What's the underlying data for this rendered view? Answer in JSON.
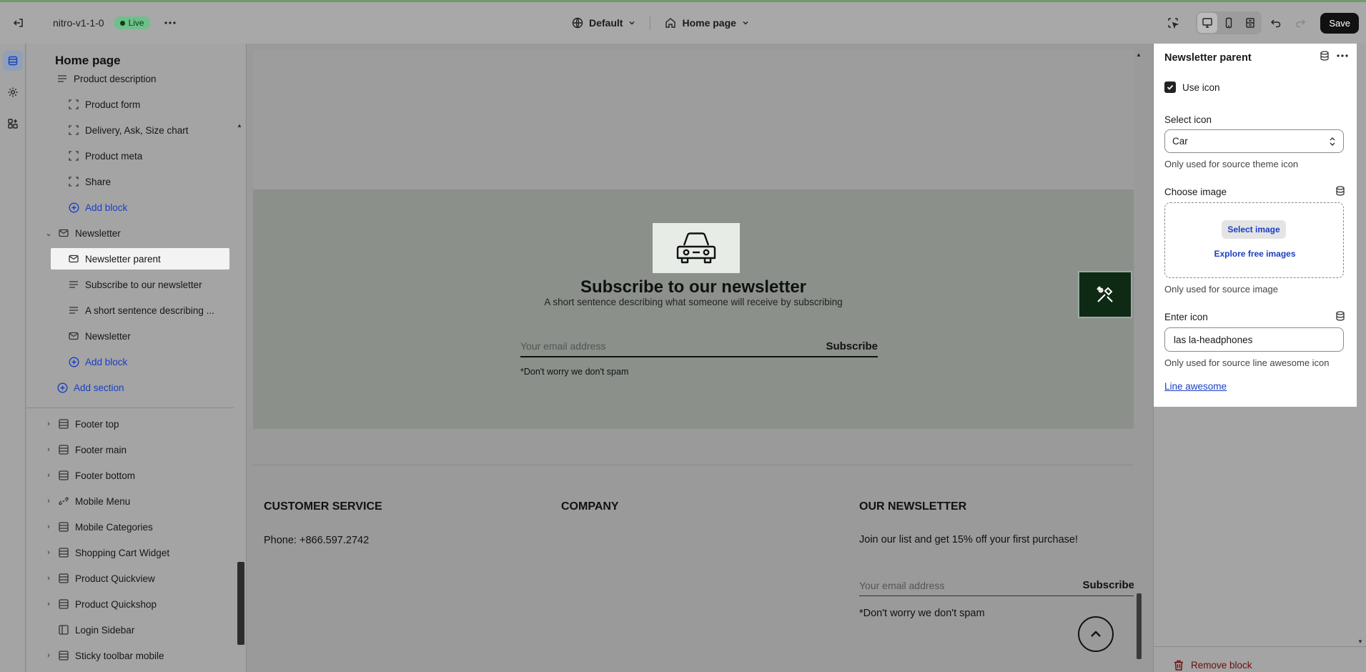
{
  "topbar": {
    "store_name": "nitro-v1-1-0",
    "status_badge": "Live",
    "theme_dropdown": "Default",
    "page_dropdown": "Home page",
    "save_label": "Save"
  },
  "left_panel": {
    "title": "Home page",
    "items": [
      {
        "label": "Product description",
        "icon": "text-lines-icon",
        "kind": "block"
      },
      {
        "label": "Product form",
        "icon": "block-dashed-icon",
        "kind": "block"
      },
      {
        "label": "Delivery, Ask, Size chart",
        "icon": "block-dashed-icon",
        "kind": "block"
      },
      {
        "label": "Product meta",
        "icon": "block-dashed-icon",
        "kind": "block"
      },
      {
        "label": "Share",
        "icon": "block-dashed-icon",
        "kind": "block"
      },
      {
        "label": "Add block",
        "icon": "plus-circle-icon",
        "kind": "add"
      },
      {
        "label": "Newsletter",
        "icon": "mail-icon",
        "kind": "section"
      },
      {
        "label": "Newsletter parent",
        "icon": "mail-icon",
        "kind": "block"
      },
      {
        "label": "Subscribe to our newsletter",
        "icon": "text-lines-icon",
        "kind": "block"
      },
      {
        "label": "A short sentence describing ...",
        "icon": "text-lines-icon",
        "kind": "block"
      },
      {
        "label": "Newsletter",
        "icon": "mail-icon",
        "kind": "block"
      },
      {
        "label": "Add block",
        "icon": "plus-circle-icon",
        "kind": "add"
      },
      {
        "label": "Add section",
        "icon": "plus-circle-icon",
        "kind": "add"
      }
    ],
    "footer_items": [
      {
        "label": "Footer top",
        "icon": "layout-icon"
      },
      {
        "label": "Footer main",
        "icon": "layout-icon"
      },
      {
        "label": "Footer bottom",
        "icon": "layout-icon"
      },
      {
        "label": "Mobile Menu",
        "icon": "link-icon"
      },
      {
        "label": "Mobile Categories",
        "icon": "layout-icon"
      },
      {
        "label": "Shopping Cart Widget",
        "icon": "layout-icon"
      },
      {
        "label": "Product Quickview",
        "icon": "layout-icon"
      },
      {
        "label": "Product Quickshop",
        "icon": "layout-icon"
      },
      {
        "label": "Login Sidebar",
        "icon": "sidebar-icon"
      },
      {
        "label": "Sticky toolbar mobile",
        "icon": "layout-icon"
      }
    ]
  },
  "preview": {
    "newsletter_title": "Subscribe to our newsletter",
    "newsletter_sub": "A short sentence describing what someone will receive by subscribing",
    "email_placeholder": "Your email address",
    "subscribe_label": "Subscribe",
    "spam_note": "*Don't worry we don't spam",
    "footer": {
      "customer_service_heading": "CUSTOMER SERVICE",
      "phone": "Phone: +866.597.2742",
      "company_heading": "COMPANY",
      "newsletter_heading": "OUR NEWSLETTER",
      "newsletter_text": "Join our list and get 15% off your first purchase!",
      "email_placeholder": "Your email address",
      "subscribe_label": "Subscribe",
      "spam_note": "*Don't worry we don't spam"
    }
  },
  "settings": {
    "title": "Newsletter parent",
    "use_icon_label": "Use icon",
    "use_icon_checked": true,
    "select_icon_label": "Select icon",
    "select_icon_value": "Car",
    "select_icon_help": "Only used for source theme icon",
    "choose_image_label": "Choose image",
    "select_image_button": "Select image",
    "explore_link": "Explore free images",
    "choose_image_help": "Only used for source image",
    "enter_icon_label": "Enter icon",
    "enter_icon_value": "las la-headphones",
    "enter_icon_help": "Only used for source line awesome icon",
    "line_awesome_link": "Line awesome",
    "remove_block_label": "Remove block"
  }
}
